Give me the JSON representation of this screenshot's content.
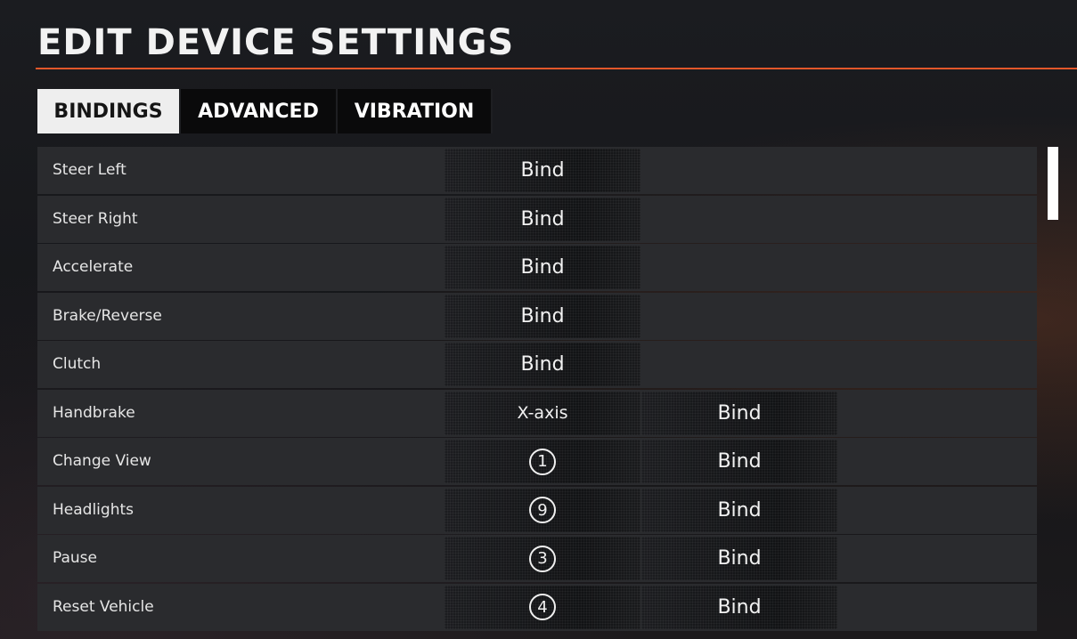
{
  "header": {
    "title": "EDIT DEVICE SETTINGS"
  },
  "tabs": [
    {
      "label": "BINDINGS",
      "active": true
    },
    {
      "label": "ADVANCED",
      "active": false
    },
    {
      "label": "VIBRATION",
      "active": false
    }
  ],
  "bindings": [
    {
      "label": "Steer Left",
      "primary": "Bind"
    },
    {
      "label": "Steer Right",
      "primary": "Bind"
    },
    {
      "label": "Accelerate",
      "primary": "Bind"
    },
    {
      "label": "Brake/Reverse",
      "primary": "Bind"
    },
    {
      "label": "Clutch",
      "primary": "Bind"
    },
    {
      "label": "Handbrake",
      "primary": "X-axis",
      "secondary": "Bind"
    },
    {
      "label": "Change View",
      "primary": "1",
      "primary_is_button": true,
      "secondary": "Bind"
    },
    {
      "label": "Headlights",
      "primary": "9",
      "primary_is_button": true,
      "secondary": "Bind"
    },
    {
      "label": "Pause",
      "primary": "3",
      "primary_is_button": true,
      "secondary": "Bind"
    },
    {
      "label": "Reset Vehicle",
      "primary": "4",
      "primary_is_button": true,
      "secondary": "Bind"
    }
  ],
  "theme": {
    "accent": "#e3572a",
    "row_bg": "#2a2b2e",
    "cell_bg": "#17181a",
    "active_tab_bg": "#eeeeee"
  }
}
